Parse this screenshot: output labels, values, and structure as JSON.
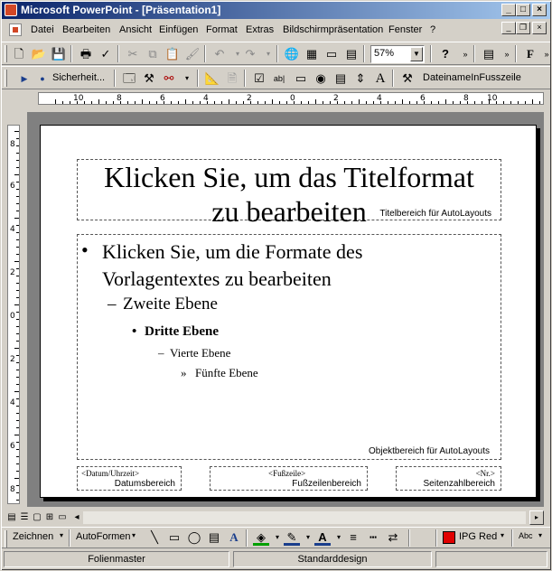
{
  "window": {
    "title": "Microsoft PowerPoint - [Präsentation1]",
    "min_label": "_",
    "max_label": "□",
    "close_label": "×"
  },
  "menu": {
    "items": [
      "Datei",
      "Bearbeiten",
      "Ansicht",
      "Einfügen",
      "Format",
      "Extras",
      "Bildschirmpräsentation",
      "Fenster",
      "?"
    ]
  },
  "toolbar": {
    "zoom": "57%",
    "security_label": "Sicherheit...",
    "filename_label": "DateinameInFusszeile",
    "font_bold_label": "F"
  },
  "ruler": {
    "h_labels": [
      "10",
      "8",
      "6",
      "4",
      "2",
      "0",
      "2",
      "4",
      "6",
      "8",
      "10"
    ],
    "v_labels": [
      "8",
      "6",
      "4",
      "2",
      "0",
      "2",
      "4",
      "6",
      "8"
    ]
  },
  "slide": {
    "title_text": "Klicken Sie, um das Titelformat zu bearbeiten",
    "title_line1": "Klicken Sie, um das Titelformat",
    "title_line2": "zu bearbeiten",
    "title_area_label": "Titelbereich für AutoLayouts",
    "body": {
      "level1": "Klicken Sie, um die Formate des Vorlagentextes zu bearbeiten",
      "level1_line1": "Klicken Sie, um die Formate des",
      "level1_line2": "Vorlagentextes zu bearbeiten",
      "level2": "Zweite Ebene",
      "level3": "Dritte Ebene",
      "level4": "Vierte Ebene",
      "level5": "Fünfte Ebene",
      "bullet1": "•",
      "bullet2": "–",
      "bullet3": "•",
      "bullet4": "–",
      "bullet5": "»"
    },
    "object_area_label": "Objektbereich für AutoLayouts",
    "date_tag": "<Datum/Uhrzeit>",
    "date_area_label": "Datumsbereich",
    "footer_tag": "<Fußzeile>",
    "footer_area_label": "Fußzeilenbereich",
    "number_tag": "<Nr.>",
    "number_area_label": "Seitenzahlbereich"
  },
  "drawing": {
    "draw_label": "Zeichnen",
    "autoshapes_label": "AutoFormen",
    "color_label": "IPG Red"
  },
  "status": {
    "view": "Folienmaster",
    "design": "Standarddesign"
  },
  "colors": {
    "title_start": "#0a246a",
    "title_end": "#a6caf0",
    "chrome": "#d4d0c8",
    "workspace": "#808080",
    "accent_red": "#e00000"
  }
}
